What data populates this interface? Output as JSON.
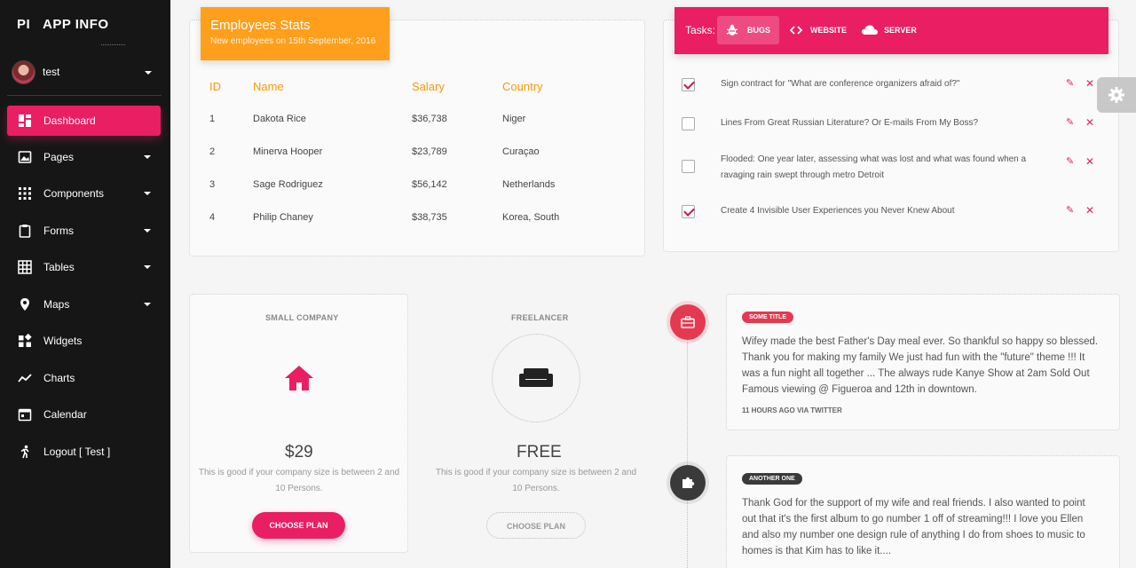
{
  "brand": {
    "mini": "PI",
    "name": "APP INFO"
  },
  "user": {
    "name": "test"
  },
  "nav": [
    {
      "label": "Dashboard",
      "icon": "dashboard-icon",
      "active": true
    },
    {
      "label": "Pages",
      "icon": "image-icon"
    },
    {
      "label": "Components",
      "icon": "apps-icon"
    },
    {
      "label": "Forms",
      "icon": "clipboard-icon"
    },
    {
      "label": "Tables",
      "icon": "grid-icon"
    },
    {
      "label": "Maps",
      "icon": "place-icon"
    },
    {
      "label": "Widgets",
      "icon": "widgets-icon"
    },
    {
      "label": "Charts",
      "icon": "timeline-icon"
    },
    {
      "label": "Calendar",
      "icon": "calendar-icon"
    },
    {
      "label": "Logout [ Test ]",
      "icon": "run-icon"
    }
  ],
  "employees": {
    "title": "Employees Stats",
    "subtitle": "New employees on 15th September, 2016",
    "columns": [
      "ID",
      "Name",
      "Salary",
      "Country"
    ],
    "rows": [
      [
        "1",
        "Dakota Rice",
        "$36,738",
        "Niger"
      ],
      [
        "2",
        "Minerva Hooper",
        "$23,789",
        "Curaçao"
      ],
      [
        "3",
        "Sage Rodriguez",
        "$56,142",
        "Netherlands"
      ],
      [
        "4",
        "Philip Chaney",
        "$38,735",
        "Korea, South"
      ]
    ]
  },
  "tasks": {
    "label": "Tasks:",
    "tabs": [
      "BUGS",
      "WEBSITE",
      "SERVER"
    ],
    "items": [
      {
        "text": "Sign contract for \"What are conference organizers afraid of?\"",
        "checked": true
      },
      {
        "text": "Lines From Great Russian Literature? Or E-mails From My Boss?",
        "checked": false
      },
      {
        "text": "Flooded: One year later, assessing what was lost and what was found when a ravaging rain swept through metro Detroit",
        "checked": false
      },
      {
        "text": "Create 4 Invisible User Experiences you Never Knew About",
        "checked": true
      }
    ]
  },
  "pricing": [
    {
      "title": "SMALL COMPANY",
      "price": "$29",
      "desc": "This is good if your company size is between 2 and 10 Persons.",
      "button": "CHOOSE PLAN"
    },
    {
      "title": "FREELANCER",
      "price": "FREE",
      "desc": "This is good if your company size is between 2 and 10 Persons.",
      "button": "CHOOSE PLAN"
    }
  ],
  "timeline": [
    {
      "tag": "SOME TITLE",
      "body": "Wifey made the best Father's Day meal ever. So thankful so happy so blessed. Thank you for making my family We just had fun with the \"future\" theme !!! It was a fun night all together ... The always rude Kanye Show at 2am Sold Out Famous viewing @ Figueroa and 12th in downtown.",
      "footer": "11 HOURS AGO VIA TWITTER"
    },
    {
      "tag": "ANOTHER ONE",
      "body": "Thank God for the support of my wife and real friends. I also wanted to point out that it's the first album to go number 1 off of streaming!!! I love you Ellen and also my number one design rule of anything I do from shoes to music to homes is that Kim has to like it....",
      "footer": ""
    }
  ],
  "colors": {
    "sidebar": "#161616",
    "accent": "#e91e63",
    "orange": "#ff9f1c"
  }
}
